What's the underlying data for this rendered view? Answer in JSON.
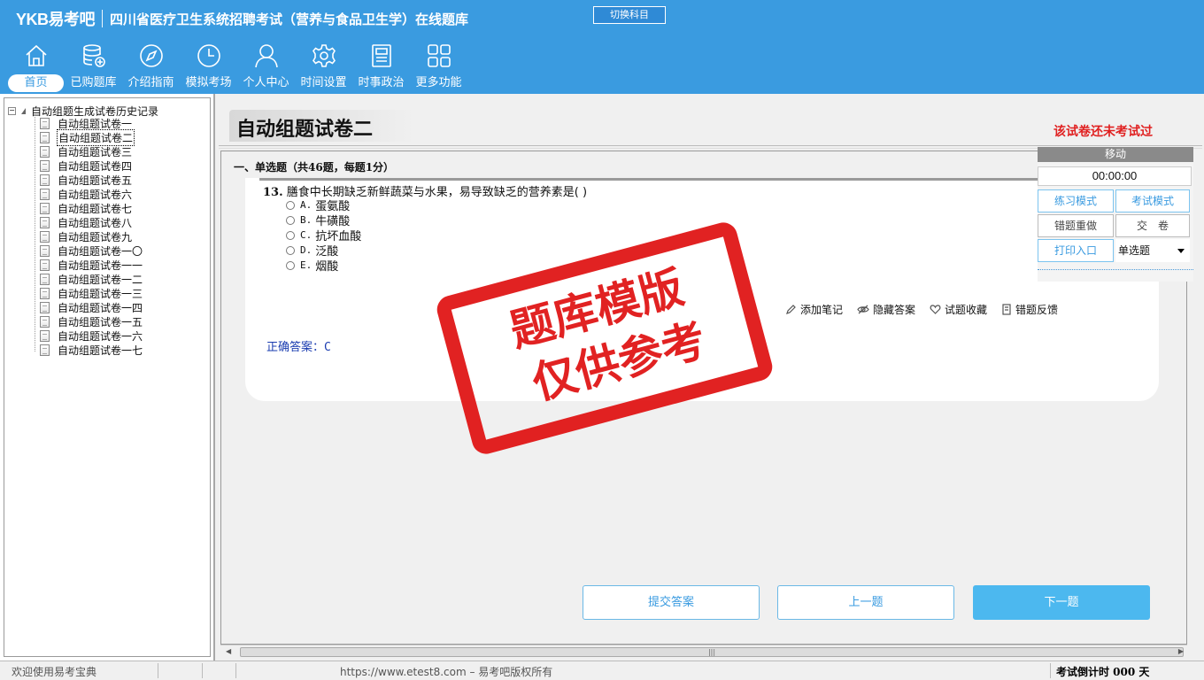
{
  "app": {
    "logo": "YKB易考吧",
    "title": "四川省医疗卫生系统招聘考试（营养与食品卫生学）在线题库",
    "switch_subject": "切换科目"
  },
  "nav": [
    {
      "label": "首页",
      "icon": "home-icon",
      "active": true
    },
    {
      "label": "已购题库",
      "icon": "database-icon"
    },
    {
      "label": "介绍指南",
      "icon": "compass-icon"
    },
    {
      "label": "模拟考场",
      "icon": "clock-icon"
    },
    {
      "label": "个人中心",
      "icon": "user-icon"
    },
    {
      "label": "时间设置",
      "icon": "gear-icon"
    },
    {
      "label": "时事政治",
      "icon": "newspaper-icon"
    },
    {
      "label": "更多功能",
      "icon": "grid-icon"
    }
  ],
  "tree": {
    "root": "自动组题生成试卷历史记录",
    "items": [
      "自动组题试卷一",
      "自动组题试卷二",
      "自动组题试卷三",
      "自动组题试卷四",
      "自动组题试卷五",
      "自动组题试卷六",
      "自动组题试卷七",
      "自动组题试卷八",
      "自动组题试卷九",
      "自动组题试卷一〇",
      "自动组题试卷一一",
      "自动组题试卷一二",
      "自动组题试卷一三",
      "自动组题试卷一四",
      "自动组题试卷一五",
      "自动组题试卷一六",
      "自动组题试卷一七"
    ],
    "selected_index": 1
  },
  "paper": {
    "title": "自动组题试卷二",
    "status": "该试卷还未考试过",
    "section": "一、单选题（共46题，每题1分）"
  },
  "question": {
    "number": "13.",
    "text": "膳食中长期缺乏新鲜蔬菜与水果，易导致缺乏的营养素是( )",
    "options": [
      {
        "key": "A.",
        "text": "蛋氨酸"
      },
      {
        "key": "B.",
        "text": "牛磺酸"
      },
      {
        "key": "C.",
        "text": "抗坏血酸"
      },
      {
        "key": "D.",
        "text": "泛酸"
      },
      {
        "key": "E.",
        "text": "烟酸"
      }
    ],
    "answer_label": "正确答案：",
    "answer": "C"
  },
  "tools": {
    "add_note": "添加笔记",
    "hide_answer": "隐藏答案",
    "favorite": "试题收藏",
    "report_error": "错题反馈"
  },
  "buttons": {
    "submit": "提交答案",
    "prev": "上一题",
    "next": "下一题"
  },
  "panel": {
    "header": "移动",
    "timer": "00:00:00",
    "practice_mode": "练习模式",
    "exam_mode": "考试模式",
    "redo_wrong": "错题重做",
    "hand_in": "交　卷",
    "print": "打印入口",
    "question_type": "单选题"
  },
  "watermark": {
    "line1": "题库模版",
    "line2": "仅供参考"
  },
  "status": {
    "welcome": "欢迎使用易考宝典",
    "copyright": "https://www.etest8.com – 易考吧版权所有",
    "countdown": "考试倒计时 000 天"
  },
  "colors": {
    "header_blue": "#3a9be0",
    "stamp_red": "#e11b1b",
    "primary_button": "#4cb8ef"
  }
}
